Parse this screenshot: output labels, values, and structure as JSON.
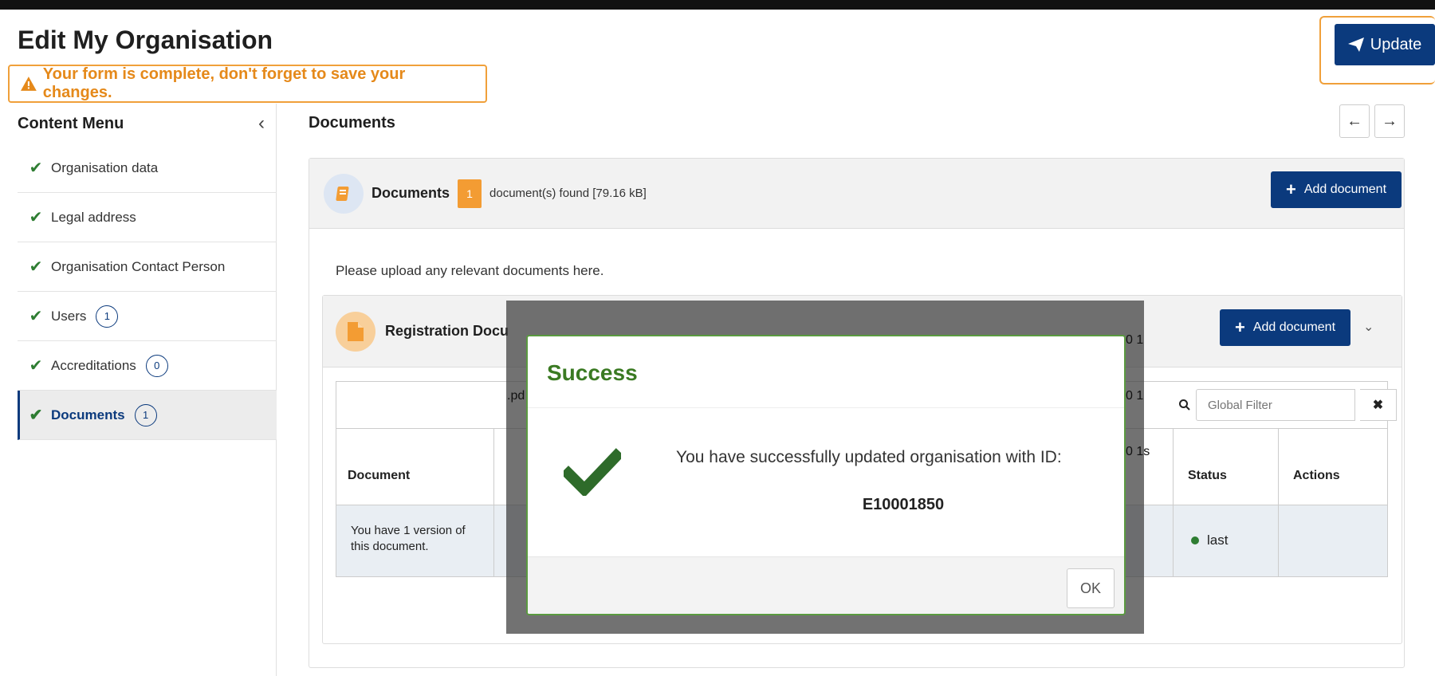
{
  "page": {
    "title": "Edit My Organisation",
    "warning": "Your form is complete, don't forget to save your changes.",
    "update_label": "Update"
  },
  "sidebar": {
    "heading": "Content Menu",
    "items": [
      {
        "label": "Organisation data",
        "count": null
      },
      {
        "label": "Legal address",
        "count": null
      },
      {
        "label": "Organisation Contact Person",
        "count": null
      },
      {
        "label": "Users",
        "count": "1"
      },
      {
        "label": "Accreditations",
        "count": "0"
      },
      {
        "label": "Documents",
        "count": "1"
      }
    ]
  },
  "main": {
    "title": "Documents",
    "panel": {
      "label": "Documents",
      "count": "1",
      "found_text": "document(s) found [79.16 kB]",
      "add_label": "Add document"
    },
    "help_text": "Please upload any relevant documents here.",
    "inner": {
      "label": "Registration Docu",
      "add_label": "Add document"
    },
    "filter_placeholder": "Global Filter",
    "table": {
      "headers": {
        "document": "Document",
        "status": "Status",
        "actions": "Actions"
      },
      "row": {
        "document": "You have 1 version of this document.",
        "status": "last"
      }
    },
    "ghost": {
      "a": "0 1",
      "b": "0 1",
      "c": "0 1s",
      "d": ".pd"
    }
  },
  "modal": {
    "title": "Success",
    "message": "You have successfully updated organisation with ID:",
    "id": "E10001850",
    "ok_label": "OK"
  },
  "colors": {
    "primary": "#0b3a7d",
    "warning": "#e5891a",
    "success": "#3a7a22"
  }
}
